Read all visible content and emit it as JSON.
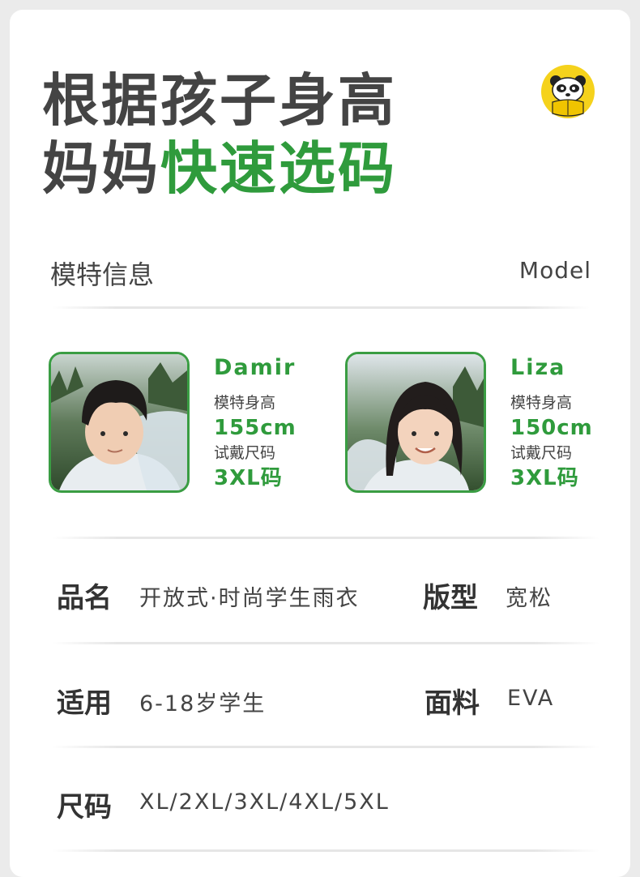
{
  "headline": {
    "line1": "根据孩子身高",
    "line2_prefix": "妈妈",
    "line2_accent": "快速选码"
  },
  "brand": {
    "icon": "panda-mascot-icon"
  },
  "models_section": {
    "title": "模特信息",
    "subtitle": "Model"
  },
  "models": [
    {
      "name": "Damir",
      "height_label": "模特身高",
      "height": "155cm",
      "size_label": "试戴尺码",
      "size": "3XL码"
    },
    {
      "name": "Liza",
      "height_label": "模特身高",
      "height": "150cm",
      "size_label": "试戴尺码",
      "size": "3XL码"
    }
  ],
  "specs": {
    "product_name_key": "品名",
    "product_name_value": "开放式·时尚学生雨衣",
    "fit_key": "版型",
    "fit_value": "宽松",
    "applicable_key": "适用",
    "applicable_value": "6-18岁学生",
    "fabric_key": "面料",
    "fabric_value": "EVA",
    "size_key": "尺码",
    "size_value": "XL/2XL/3XL/4XL/5XL"
  },
  "colors": {
    "accent": "#2f9b3c",
    "border": "#3a9d43",
    "text": "#444444",
    "mascot": "#f5d21c"
  }
}
